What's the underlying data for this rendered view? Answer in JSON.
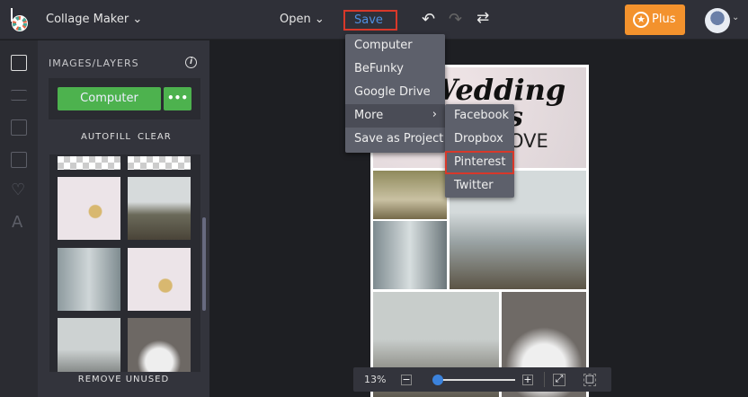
{
  "topbar": {
    "app_name": "Collage Maker",
    "open_label": "Open",
    "save_label": "Save",
    "plus_label": "Plus"
  },
  "sidebar": {
    "title": "IMAGES/LAYERS",
    "upload_label": "Computer",
    "more_label": "•••",
    "autofill_label": "AUTOFILL",
    "clear_label": "CLEAR",
    "remove_unused_label": "REMOVE UNUSED",
    "rail_icons": [
      "image-icon",
      "sliders-icon",
      "layout-icon",
      "texture-icon",
      "heart-icon",
      "text-icon"
    ]
  },
  "save_menu": {
    "items": [
      "Computer",
      "BeFunky",
      "Google Drive",
      "More",
      "Save as Project"
    ],
    "submenu": [
      "Facebook",
      "Dropbox",
      "Pinterest",
      "Twitter"
    ]
  },
  "collage": {
    "line1": "Wedding",
    "line2": "s",
    "line3": "LOVE"
  },
  "zoom": {
    "level": "13%",
    "value_percent": 13
  },
  "colors": {
    "accent_green": "#4db24e",
    "plus_orange": "#f3922d",
    "highlight_red": "#d8382a",
    "save_blue": "#4f8fe0"
  }
}
